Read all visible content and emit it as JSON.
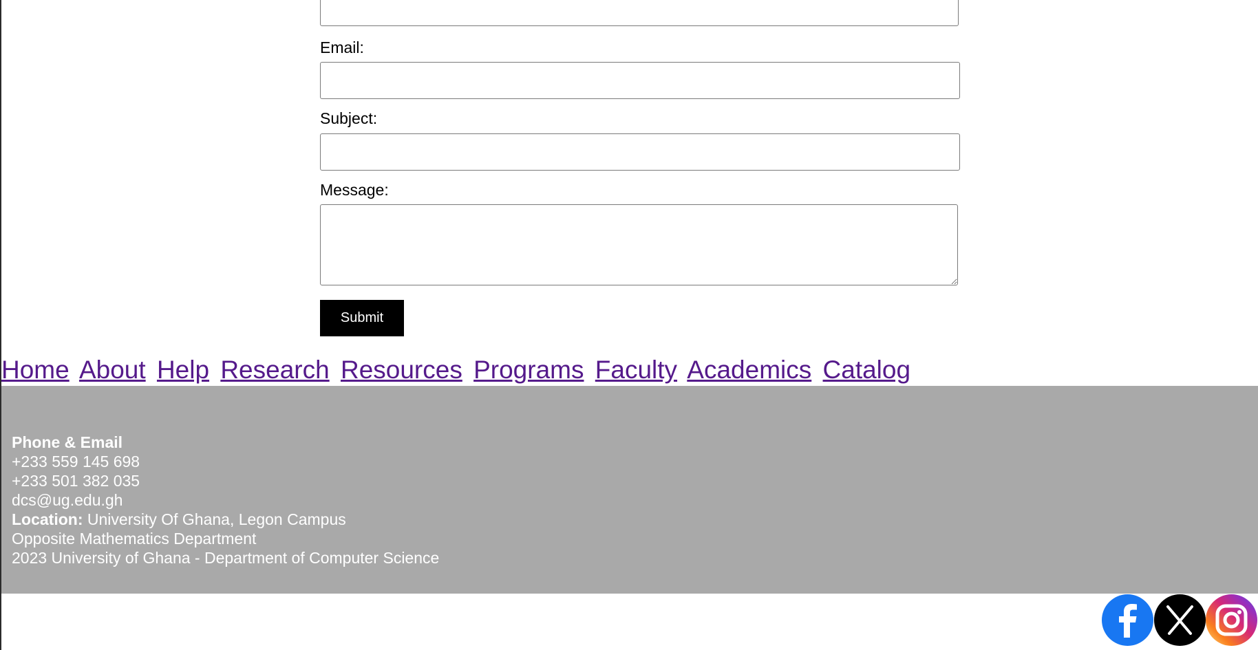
{
  "form": {
    "email_label": "Email:",
    "subject_label": "Subject:",
    "message_label": "Message:",
    "email_value": "",
    "subject_value": "",
    "message_value": "",
    "submit_label": "Submit"
  },
  "nav": {
    "links": [
      "Home",
      "About",
      "Help",
      "Research",
      "Resources",
      "Programs",
      "Faculty",
      "Academics",
      "Catalog"
    ]
  },
  "footer": {
    "contact_heading": "Phone & Email",
    "phone_1": "+233 559 145 698",
    "phone_2": "+233 501 382 035",
    "email": "dcs@ug.edu.gh",
    "location_label": "Location:",
    "location_value": " University Of Ghana, Legon Campus",
    "location_line2": "Opposite Mathematics Department",
    "copyright": "2023 University of Ghana - Department of Computer Science"
  },
  "social": {
    "icons": [
      "facebook-icon",
      "x-icon",
      "instagram-icon"
    ],
    "colors": {
      "facebook": "#1877f2",
      "x": "#000000",
      "instagram": "#d62976"
    }
  },
  "colors": {
    "footer_bg": "#a9a9a9",
    "link": "#551a8b",
    "button_bg": "#000000"
  }
}
